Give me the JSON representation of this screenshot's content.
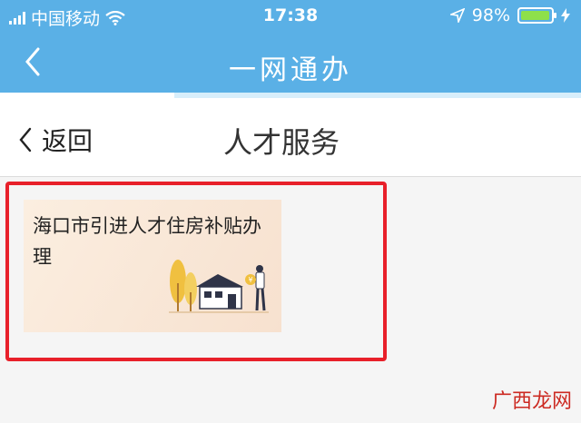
{
  "status_bar": {
    "carrier": "中国移动",
    "time": "17:38",
    "battery_percent": "98%",
    "battery_level": 0.98
  },
  "navbar": {
    "title": "一网通办",
    "back_icon": "chevron-left-icon",
    "load_progress": 0.3
  },
  "subheader": {
    "back_label": "返回",
    "title": "人才服务"
  },
  "service_card": {
    "title": "海口市引进人才住房补贴办理",
    "illustration": "house-with-person-illustration"
  },
  "watermark": "广西龙网",
  "colors": {
    "header_bg": "#5ab0e6",
    "highlight_border": "#e8202a",
    "card_bg": "#f7e1cf",
    "battery_fill": "#8ee04a"
  }
}
